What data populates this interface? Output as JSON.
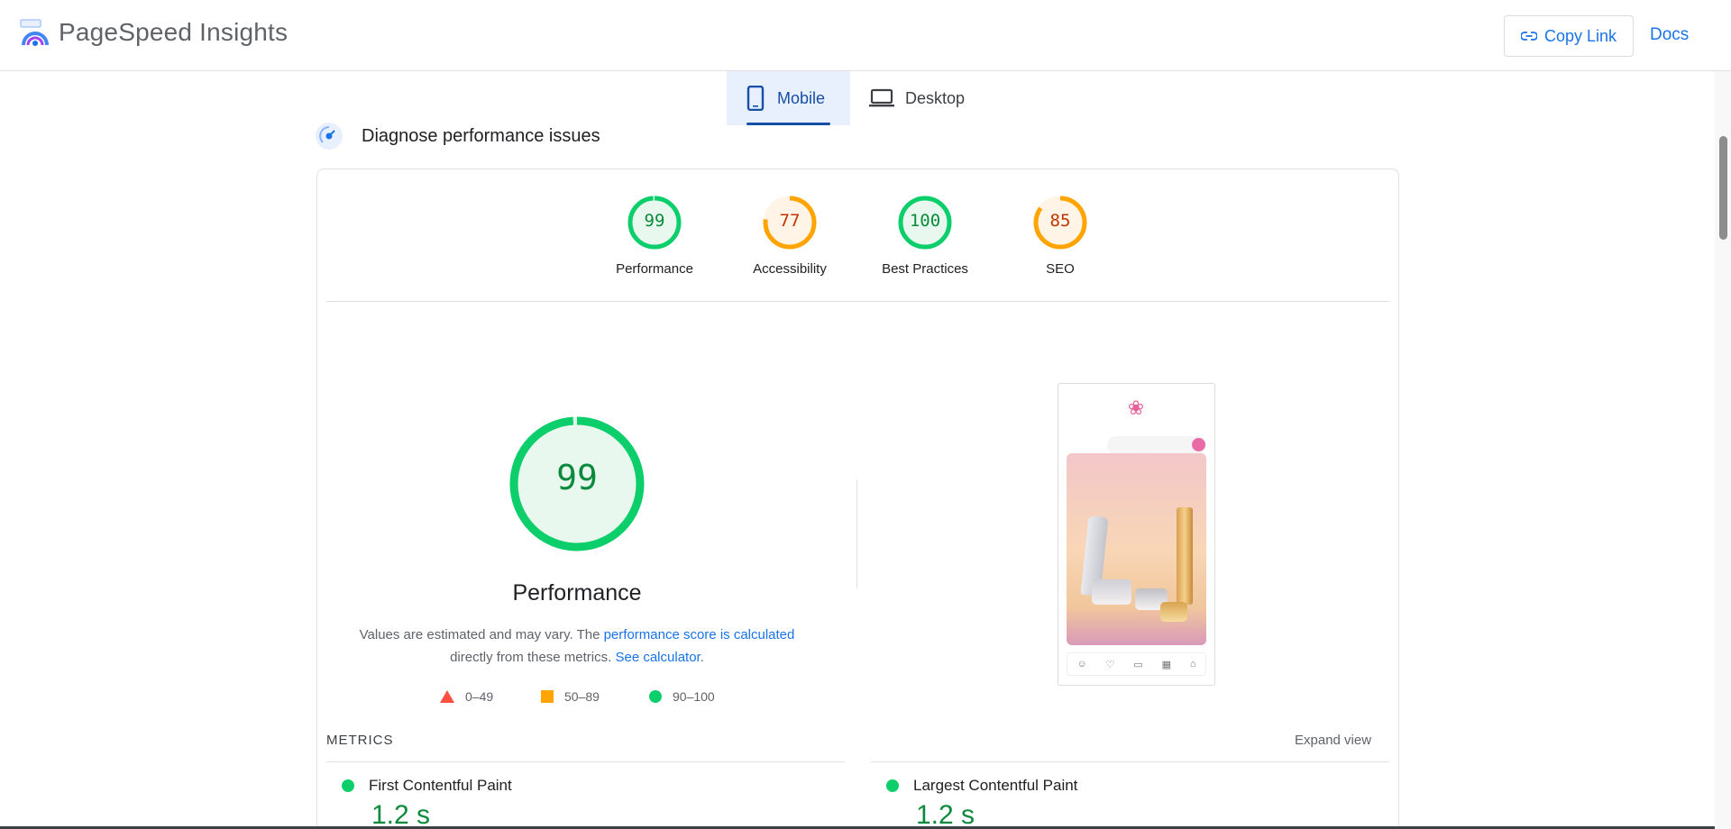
{
  "header": {
    "brand": "PageSpeed Insights",
    "copy_link": "Copy Link",
    "docs": "Docs"
  },
  "tabs": {
    "mobile": "Mobile",
    "desktop": "Desktop"
  },
  "section": {
    "title": "Diagnose performance issues"
  },
  "scores": [
    {
      "value": "99",
      "label": "Performance",
      "score": 99,
      "color": "#0cce6b",
      "bg": "#e8f8ee",
      "text": "#0a8a3c"
    },
    {
      "value": "77",
      "label": "Accessibility",
      "score": 77,
      "color": "#ffa400",
      "bg": "#fff4e5",
      "text": "#c33300"
    },
    {
      "value": "100",
      "label": "Best Practices",
      "score": 100,
      "color": "#0cce6b",
      "bg": "#e8f8ee",
      "text": "#0a8a3c"
    },
    {
      "value": "85",
      "label": "SEO",
      "score": 85,
      "color": "#ffa400",
      "bg": "#fff4e5",
      "text": "#c33300"
    }
  ],
  "main_score": {
    "value": "99",
    "label": "Performance",
    "note_prefix": "Values are estimated and may vary. The ",
    "note_link1": "performance score is calculated",
    "note_mid": "directly from these metrics.",
    "note_link2": "See calculator",
    "note_end": "."
  },
  "legend": [
    {
      "label": "0–49",
      "color": "#ff4e42"
    },
    {
      "label": "50–89",
      "color": "#ffa400"
    },
    {
      "label": "90–100",
      "color": "#0cce6b"
    }
  ],
  "metrics": {
    "heading": "METRICS",
    "expand": "Expand view",
    "items": [
      {
        "name": "First Contentful Paint",
        "value": "1.2 s"
      },
      {
        "name": "Largest Contentful Paint",
        "value": "1.2 s"
      }
    ]
  },
  "colors": {
    "accent": "#1a73e8",
    "pass": "#0cce6b",
    "average": "#ffa400",
    "fail": "#ff4e42"
  }
}
